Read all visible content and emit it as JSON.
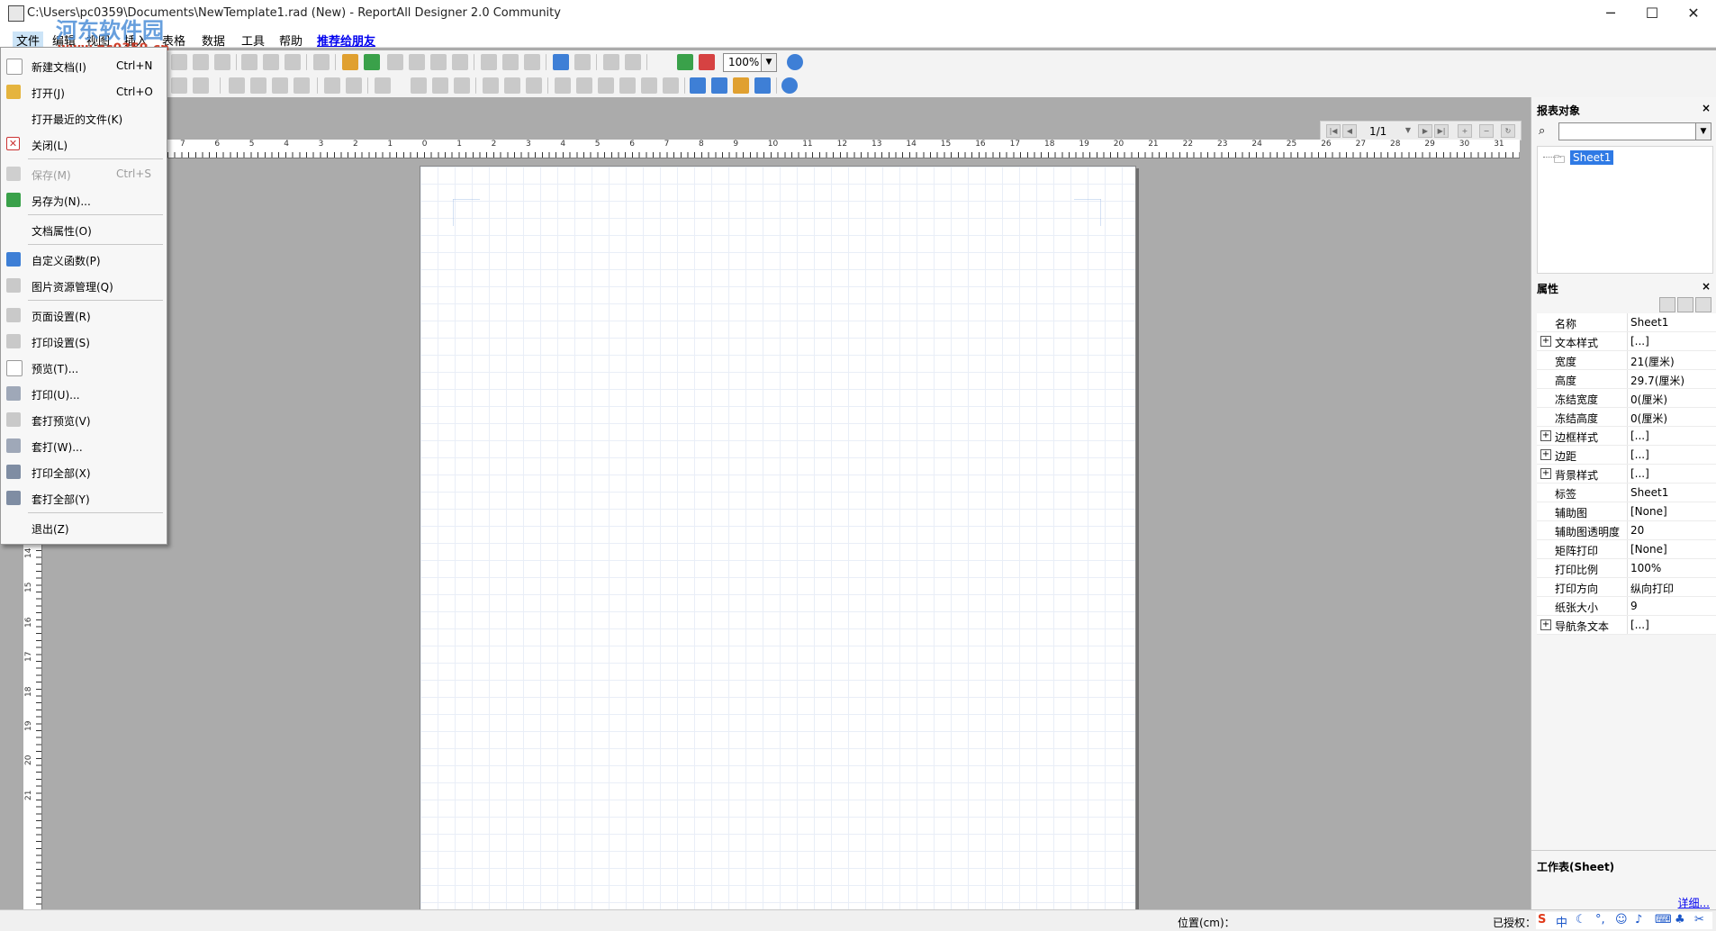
{
  "window": {
    "title": "C:\\Users\\pc0359\\Documents\\NewTemplate1.rad (New) - ReportAll Designer 2.0 Community",
    "minimize": "─",
    "maximize": "☐",
    "close": "✕"
  },
  "watermark": {
    "text": "河东软件园",
    "url": "www.pc0359.cn"
  },
  "menubar": {
    "items": [
      "文件",
      "编辑",
      "视图",
      "插入",
      "表格",
      "数据",
      "工具",
      "帮助"
    ],
    "recommend": "推荐给朋友"
  },
  "toolbar": {
    "zoom": "100%"
  },
  "file_menu": {
    "items": [
      {
        "label": "新建文档(I)",
        "shortcut": "Ctrl+N",
        "icon": "new-document-icon"
      },
      {
        "label": "打开(J)",
        "shortcut": "Ctrl+O",
        "icon": "open-folder-icon"
      },
      {
        "label": "打开最近的文件(K)",
        "shortcut": "",
        "icon": ""
      },
      {
        "label": "关闭(L)",
        "shortcut": "",
        "icon": "close-document-icon"
      },
      {
        "label": "保存(M)",
        "shortcut": "Ctrl+S",
        "icon": "save-icon",
        "disabled": true
      },
      {
        "label": "另存为(N)...",
        "shortcut": "",
        "icon": "save-as-icon"
      },
      {
        "label": "文档属性(O)",
        "shortcut": "",
        "icon": ""
      },
      {
        "label": "自定义函数(P)",
        "shortcut": "",
        "icon": "function-icon"
      },
      {
        "label": "图片资源管理(Q)",
        "shortcut": "",
        "icon": "image-resource-icon"
      },
      {
        "label": "页面设置(R)",
        "shortcut": "",
        "icon": "page-setup-icon"
      },
      {
        "label": "打印设置(S)",
        "shortcut": "",
        "icon": "print-setup-icon"
      },
      {
        "label": "预览(T)...",
        "shortcut": "",
        "icon": "preview-icon"
      },
      {
        "label": "打印(U)...",
        "shortcut": "",
        "icon": "print-icon"
      },
      {
        "label": "套打预览(V)",
        "shortcut": "",
        "icon": "overlay-preview-icon"
      },
      {
        "label": "套打(W)...",
        "shortcut": "",
        "icon": "overlay-print-icon"
      },
      {
        "label": "打印全部(X)",
        "shortcut": "",
        "icon": "print-all-icon"
      },
      {
        "label": "套打全部(Y)",
        "shortcut": "",
        "icon": "overlay-print-all-icon"
      },
      {
        "label": "退出(Z)",
        "shortcut": "",
        "icon": ""
      }
    ]
  },
  "page_nav": {
    "counter": "1/1"
  },
  "ruler": {
    "h_ticks": [
      "7",
      "6",
      "5",
      "4",
      "3",
      "2",
      "1",
      "0",
      "1",
      "2",
      "3",
      "4",
      "5",
      "6",
      "7",
      "8",
      "9",
      "10",
      "11",
      "12",
      "13",
      "14",
      "15",
      "16",
      "17",
      "18",
      "19",
      "20",
      "21",
      "22",
      "23",
      "24",
      "25",
      "26",
      "27",
      "28",
      "29",
      "30",
      "31"
    ],
    "v_ticks": [
      "14",
      "15",
      "16",
      "17",
      "18",
      "19",
      "20",
      "21"
    ]
  },
  "report_objects": {
    "title": "报表对象",
    "root": "Sheet1"
  },
  "properties": {
    "title": "属性",
    "rows": [
      {
        "name": "名称",
        "value": "Sheet1",
        "expandable": false
      },
      {
        "name": "文本样式",
        "value": "[...]",
        "expandable": true
      },
      {
        "name": "宽度",
        "value": "21(厘米)",
        "expandable": false
      },
      {
        "name": "高度",
        "value": "29.7(厘米)",
        "expandable": false
      },
      {
        "name": "冻结宽度",
        "value": "0(厘米)",
        "expandable": false
      },
      {
        "name": "冻结高度",
        "value": "0(厘米)",
        "expandable": false
      },
      {
        "name": "边框样式",
        "value": "[...]",
        "expandable": true
      },
      {
        "name": "边距",
        "value": "[...]",
        "expandable": true
      },
      {
        "name": "背景样式",
        "value": "[...]",
        "expandable": true
      },
      {
        "name": "标签",
        "value": "Sheet1",
        "expandable": false
      },
      {
        "name": "辅助图",
        "value": "[None]",
        "expandable": false
      },
      {
        "name": "辅助图透明度",
        "value": "20",
        "expandable": false
      },
      {
        "name": "矩阵打印",
        "value": "[None]",
        "expandable": false
      },
      {
        "name": "打印比例",
        "value": "100%",
        "expandable": false
      },
      {
        "name": "打印方向",
        "value": "纵向打印",
        "expandable": false
      },
      {
        "name": "纸张大小",
        "value": "9",
        "expandable": false
      },
      {
        "name": "导航条文本",
        "value": "[...]",
        "expandable": true
      }
    ],
    "description": "工作表(Sheet)",
    "more": "详细..."
  },
  "statusbar": {
    "position": "位置(cm)：",
    "authorized": "已授权："
  }
}
